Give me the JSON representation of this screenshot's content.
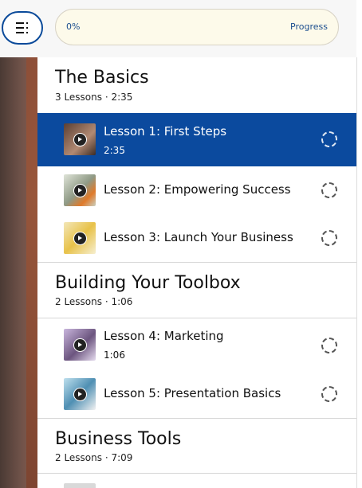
{
  "header": {
    "progress_value": "0%",
    "progress_label": "Progress",
    "progress_fraction": 0
  },
  "sections": [
    {
      "title": "The Basics",
      "meta": "3 Lessons · 2:35",
      "lessons": [
        {
          "title": "Lesson 1: First Steps",
          "duration": "2:35",
          "active": true,
          "thumb_color": "#8a6a55"
        },
        {
          "title": "Lesson 2: Empowering Success",
          "duration": "",
          "active": false,
          "thumb_color": "#b9c2b0"
        },
        {
          "title": "Lesson 3: Launch Your Business",
          "duration": "",
          "active": false,
          "thumb_color": "#e3c36a"
        }
      ]
    },
    {
      "title": "Building Your Toolbox",
      "meta": "2 Lessons · 1:06",
      "lessons": [
        {
          "title": "Lesson 4: Marketing",
          "duration": "1:06",
          "active": false,
          "thumb_color": "#9b86b4"
        },
        {
          "title": "Lesson 5: Presentation Basics",
          "duration": "",
          "active": false,
          "thumb_color": "#7fb0c8"
        }
      ]
    },
    {
      "title": "Business Tools",
      "meta": "2 Lessons · 7:09",
      "lessons": []
    }
  ],
  "colors": {
    "accent": "#0b4a9e",
    "progress_bg": "#fdfaea"
  }
}
